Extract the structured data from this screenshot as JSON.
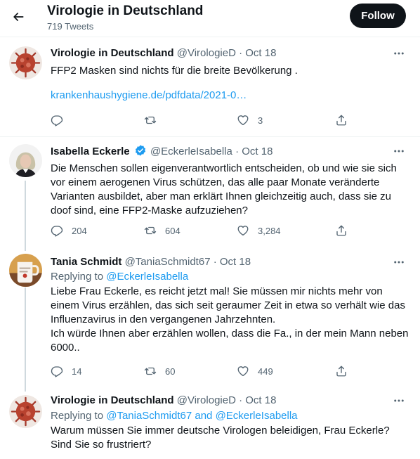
{
  "header": {
    "title": "Virologie in Deutschland",
    "tweet_count": "719 Tweets",
    "follow_label": "Follow"
  },
  "tweets": [
    {
      "name": "Virologie in Deutschland",
      "handle": "@VirologieD",
      "sep": "·",
      "date": "Oct 18",
      "text": "FFP2 Masken sind nichts für die breite Bevölkerung .",
      "link": "krankenhaushygiene.de/pdfdata/2021-0…",
      "reply_count": "",
      "retweet_count": "",
      "like_count": "3",
      "avatar_icon": "virus-avatar"
    },
    {
      "name": "Isabella Eckerle",
      "handle": "@EckerleIsabella",
      "sep": "·",
      "date": "Oct 18",
      "verified": true,
      "text": "Die Menschen sollen eigenverantwortlich entscheiden, ob und wie sie sich vor einem aerogenen Virus schützen, das alle paar Monate veränderte Varianten ausbildet, aber man erklärt Ihnen gleichzeitig auch, dass sie zu doof sind, eine FFP2-Maske aufzuziehen?",
      "reply_count": "204",
      "retweet_count": "604",
      "like_count": "3,284",
      "avatar_icon": "person-photo-avatar"
    },
    {
      "name": "Tania Schmidt",
      "handle": "@TaniaSchmidt67",
      "sep": "·",
      "date": "Oct 18",
      "replying_label": "Replying to",
      "replying_to": "@EckerleIsabella",
      "text": "Liebe Frau Eckerle, es reicht jetzt mal! Sie müssen mir nichts mehr von einem Virus erzählen, das sich seit geraumer Zeit in etwa so verhält wie das Influenzavirus in den vergangenen Jahrzehnten.\nIch würde Ihnen aber erzählen wollen, dass die Fa., in der mein Mann neben 6000..",
      "reply_count": "14",
      "retweet_count": "60",
      "like_count": "449",
      "avatar_icon": "mug-avatar"
    },
    {
      "name": "Virologie in Deutschland",
      "handle": "@VirologieD",
      "sep": "·",
      "date": "Oct 18",
      "replying_label": "Replying to",
      "replying_to_1": "@TaniaSchmidt67",
      "replying_and": "and",
      "replying_to_2": "@EckerleIsabella",
      "text": "Warum müssen Sie immer deutsche Virologen beleidigen, Frau Eckerle? Sind Sie so frustriert?",
      "avatar_icon": "virus-avatar"
    }
  ],
  "colors": {
    "accent": "#1d9bf0",
    "text": "#0f1419",
    "secondary": "#536471",
    "follow_bg": "#0f1419",
    "thread_line": "#cfd9de"
  }
}
